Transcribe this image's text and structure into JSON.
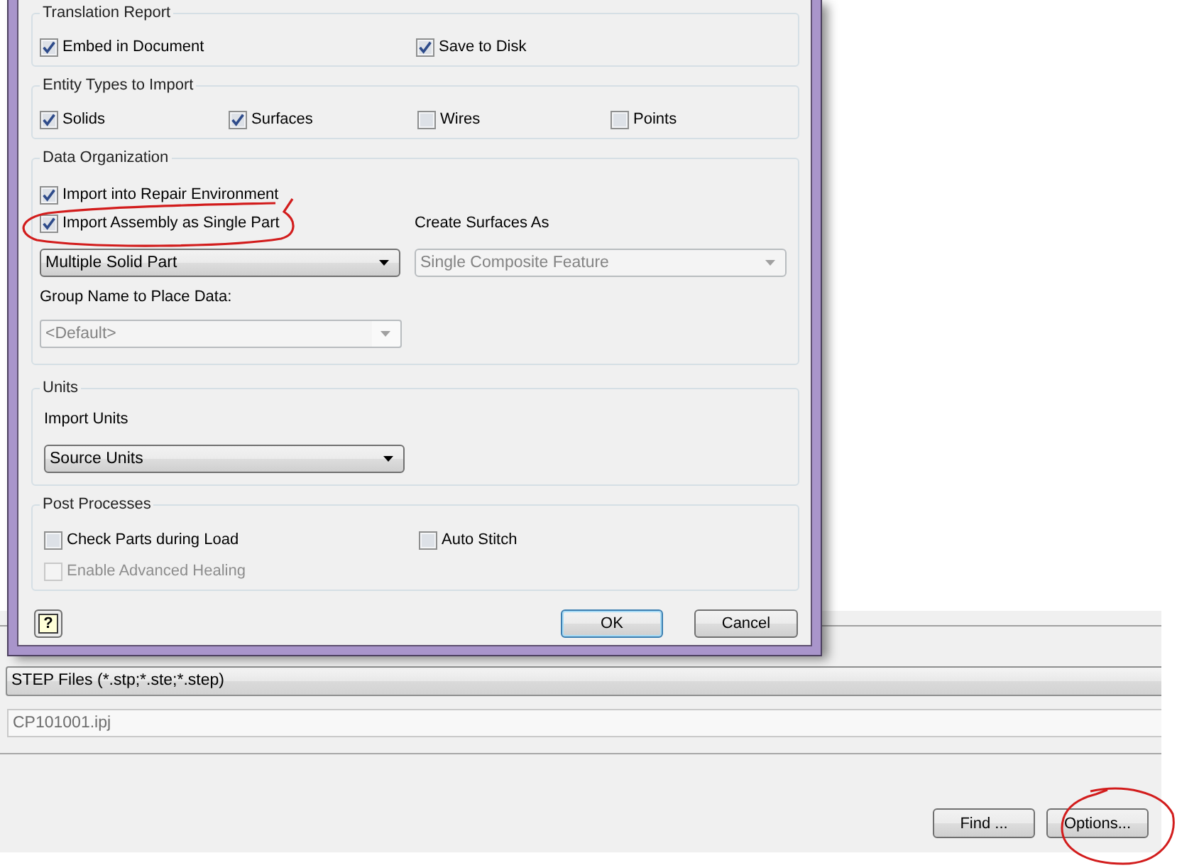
{
  "import_options_dialog": {
    "translation_report": {
      "title": "Translation Report",
      "options": [
        {
          "label": "Embed in Document",
          "checked": true
        },
        {
          "label": "Save to Disk",
          "checked": true
        }
      ]
    },
    "entity_types": {
      "title": "Entity Types to Import",
      "options": [
        {
          "label": "Solids",
          "checked": true
        },
        {
          "label": "Surfaces",
          "checked": true
        },
        {
          "label": "Wires",
          "checked": false
        },
        {
          "label": "Points",
          "checked": false
        }
      ]
    },
    "data_organization": {
      "title": "Data Organization",
      "options": [
        {
          "label": "Import into Repair Environment",
          "checked": true,
          "circled": false
        },
        {
          "label": "Import Assembly as Single Part",
          "checked": true,
          "circled": true
        }
      ],
      "part_type": {
        "value": "Multiple Solid Part",
        "disabled": false
      },
      "create_surfaces": {
        "label": "Create Surfaces As",
        "value": "Single Composite Feature",
        "disabled": true
      },
      "group_name": {
        "label": "Group Name to Place Data:",
        "value": "<Default>",
        "disabled": true
      }
    },
    "units": {
      "title": "Units",
      "import_units": {
        "label": "Import Units",
        "value": "Source Units",
        "disabled": false
      }
    },
    "post_processes": {
      "title": "Post Processes",
      "options": [
        {
          "label": "Check Parts during Load",
          "checked": false,
          "disabled": false
        },
        {
          "label": "Auto Stitch",
          "checked": false,
          "disabled": false
        },
        {
          "label": "Enable Advanced Healing",
          "checked": false,
          "disabled": true
        }
      ]
    },
    "help_button": {
      "symbol": "?"
    },
    "buttons": [
      {
        "label": "OK",
        "default": true
      },
      {
        "label": "Cancel",
        "default": false
      }
    ]
  },
  "file_open_window": {
    "file_type": {
      "value": "STEP Files (*.stp;*.ste;*.step)"
    },
    "project": {
      "value": "CP101001.ipj",
      "disabled": true
    },
    "buttons": [
      {
        "label": "Find ...",
        "circled": false
      },
      {
        "label": "Options...",
        "circled": true
      }
    ]
  }
}
